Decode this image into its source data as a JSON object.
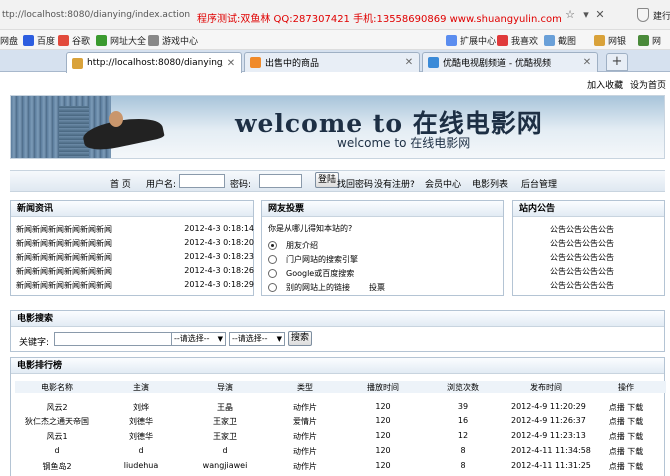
{
  "browser": {
    "url": "ttp://localhost:8080/dianying/index.action",
    "ad_text": "程序测试:双鱼林 QQ:287307421 手机:13558690869 www.shuangyulin.com",
    "extra_label": "建行"
  },
  "bookmarks": [
    {
      "label": "网盘",
      "color": "#f0f0f0"
    },
    {
      "label": "百度",
      "color": "#2d5ee0"
    },
    {
      "label": "谷歌",
      "color": "#e24a3b"
    },
    {
      "label": "网址大全",
      "color": "#3a9a2e"
    },
    {
      "label": "游戏中心",
      "color": "#888888"
    },
    {
      "label": "扩展中心",
      "color": "#5b8def"
    },
    {
      "label": "我喜欢",
      "color": "#e03a3a"
    },
    {
      "label": "截图",
      "color": "#6aa0d8"
    },
    {
      "label": "网银",
      "color": "#d9a23a"
    },
    {
      "label": "网",
      "color": "#4a8a3a"
    }
  ],
  "tabs": [
    {
      "label": "http://localhost:8080/dianying/ind...",
      "icon_color": "#d9a23a",
      "active": true
    },
    {
      "label": "出售中的商品",
      "icon_color": "#f08a2a",
      "active": false
    },
    {
      "label": "优酷电视剧频道 - 优酷视频",
      "icon_color": "#3a8ad8",
      "active": false
    }
  ],
  "top_links": [
    "加入收藏",
    "设为首页"
  ],
  "banner": {
    "title": "welcome to 在线电影网",
    "subtitle": "welcome to 在线电影网"
  },
  "nav": {
    "home": "首 页",
    "username_label": "用户名:",
    "password_label": "密码:",
    "login_button": "登陆",
    "links": [
      "找回密码",
      "没有注册?",
      "会员中心",
      "电影列表",
      "后台管理"
    ]
  },
  "news": {
    "title": "新闻资讯",
    "items": [
      {
        "title": "新闻新闻新闻新闻新闻新闻",
        "time": "2012-4-3 0:18:14"
      },
      {
        "title": "新闻新闻新闻新闻新闻新闻",
        "time": "2012-4-3 0:18:20"
      },
      {
        "title": "新闻新闻新闻新闻新闻新闻",
        "time": "2012-4-3 0:18:23"
      },
      {
        "title": "新闻新闻新闻新闻新闻新闻",
        "time": "2012-4-3 0:18:26"
      },
      {
        "title": "新闻新闻新闻新闻新闻新闻",
        "time": "2012-4-3 0:18:29"
      }
    ]
  },
  "poll": {
    "title": "网友投票",
    "question": "你是从哪儿得知本站的?",
    "options": [
      "朋友介绍",
      "门户网站的搜索引擎",
      "Google或百度搜索",
      "别的网站上的链接"
    ],
    "vote_label": "投票"
  },
  "notice": {
    "title": "站内公告",
    "items": [
      "公告公告公告公告",
      "公告公告公告公告",
      "公告公告公告公告",
      "公告公告公告公告",
      "公告公告公告公告"
    ]
  },
  "search": {
    "title": "电影搜索",
    "keyword_label": "关键字:",
    "select1": "--请选择--",
    "select2": "--请选择--",
    "button": "搜索"
  },
  "ranking": {
    "title": "电影排行榜",
    "columns": [
      "电影名称",
      "主演",
      "导演",
      "类型",
      "播放时间",
      "浏览次数",
      "发布时间",
      "操作"
    ],
    "rows": [
      [
        "风云2",
        "刘烨",
        "王晶",
        "动作片",
        "120",
        "39",
        "2012-4-9 11:20:29",
        "点播 下载"
      ],
      [
        "狄仁杰之通天帝国",
        "刘德华",
        "王家卫",
        "爱情片",
        "120",
        "16",
        "2012-4-9 11:26:37",
        "点播 下载"
      ],
      [
        "风云1",
        "刘德华",
        "王家卫",
        "动作片",
        "120",
        "12",
        "2012-4-9 11:23:13",
        "点播 下载"
      ],
      [
        "d",
        "d",
        "d",
        "动作片",
        "120",
        "8",
        "2012-4-11 11:34:58",
        "点播 下载"
      ],
      [
        "钢鱼岛2",
        "liudehua",
        "wangjiawei",
        "动作片",
        "120",
        "8",
        "2012-4-11 11:31:25",
        "点播 下载"
      ]
    ]
  }
}
